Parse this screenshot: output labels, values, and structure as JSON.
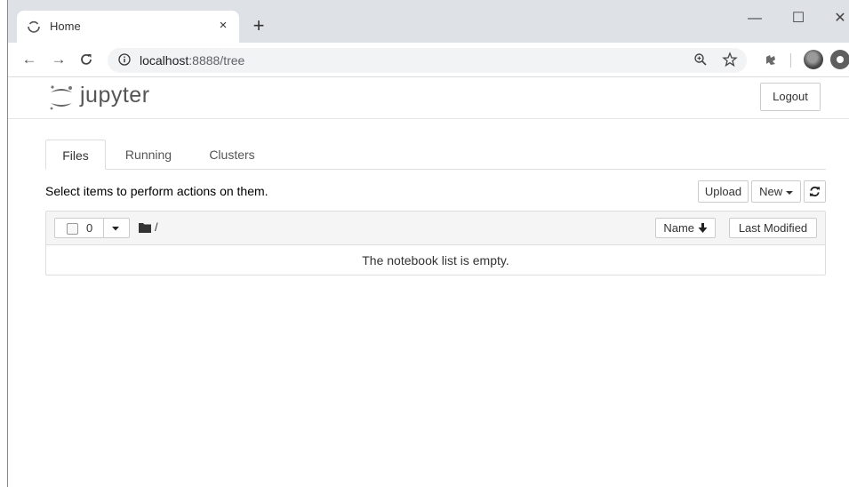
{
  "browser": {
    "tab_title": "Home",
    "tab_close": "×",
    "new_tab": "+",
    "window_controls": {
      "minimize": "—",
      "maximize": "☐",
      "close": "✕"
    },
    "nav": {
      "back": "←",
      "forward": "→",
      "reload": "C"
    },
    "url_host": "localhost",
    "url_rest": ":8888/tree",
    "icons": [
      "info-icon",
      "zoom-icon",
      "star-icon",
      "extension-icon",
      "profile-avatar",
      "extension-circle-icon"
    ]
  },
  "jupyter": {
    "logo_text": "jupyter",
    "logout_label": "Logout",
    "tabs": [
      {
        "label": "Files",
        "active": true
      },
      {
        "label": "Running",
        "active": false
      },
      {
        "label": "Clusters",
        "active": false
      }
    ],
    "instructions": "Select items to perform actions on them.",
    "upload_label": "Upload",
    "new_label": "New",
    "list": {
      "selected_count": "0",
      "path": "/",
      "sort_name_label": "Name",
      "last_modified_label": "Last Modified",
      "empty_message": "The notebook list is empty."
    }
  },
  "colors": {
    "titlebar": "#dee1e6",
    "omnibox": "#f1f3f4",
    "list_header": "#f5f5f5",
    "border": "#dddddd"
  }
}
